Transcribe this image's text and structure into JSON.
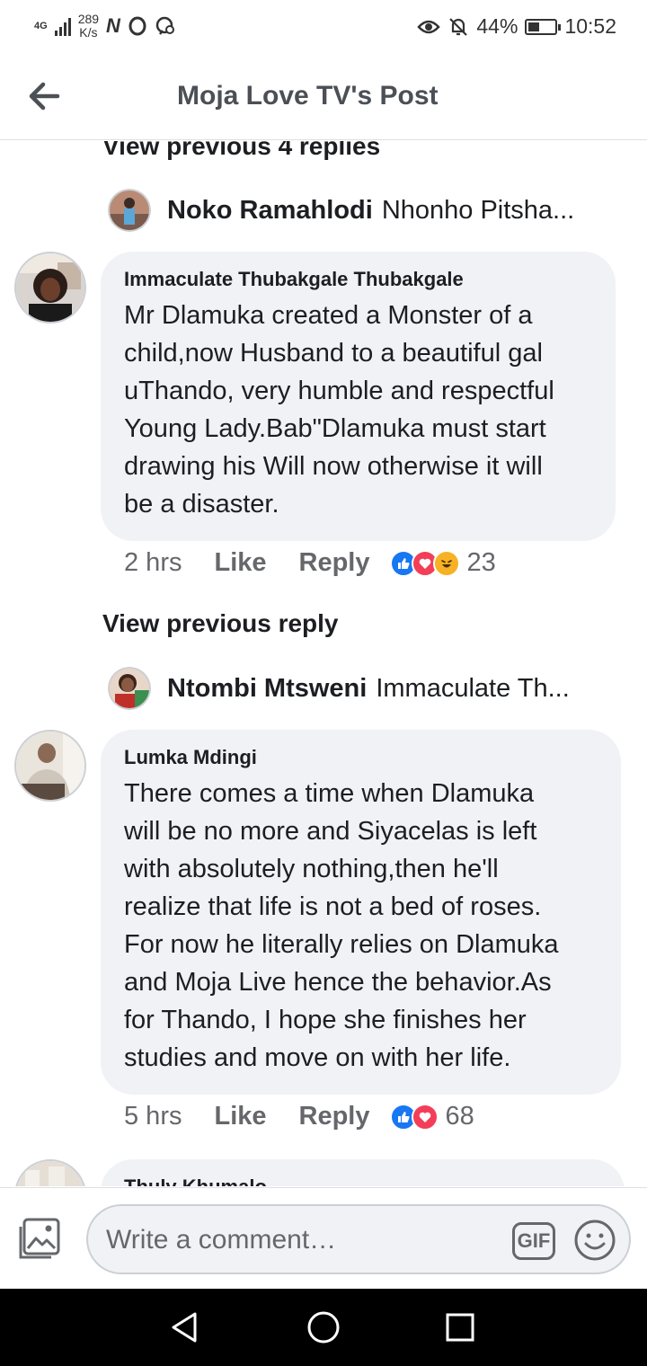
{
  "status_bar": {
    "network": "4G",
    "speed_value": "289",
    "speed_unit": "K/s",
    "glyph_n": "N",
    "battery_percent": "44%",
    "battery_level": 0.44,
    "time": "10:52"
  },
  "header": {
    "title": "Moja Love TV's Post"
  },
  "thread": {
    "view_previous_4": "View previous 4 replies",
    "reply_1": {
      "name": "Noko Ramahlodi",
      "preview": "Nhonho Pitsha..."
    },
    "comment_1": {
      "name": "Immaculate Thubakgale Thubakgale",
      "lines": [
        "Mr Dlamuka created a Monster of a",
        "child,now Husband to a beautiful gal",
        "uThando, very humble and respectful",
        "Young Lady.Bab\"Dlamuka must start",
        "drawing his Will now otherwise it will",
        "be a disaster."
      ],
      "time": "2 hrs",
      "like": "Like",
      "reply": "Reply",
      "reaction_count": "23"
    },
    "view_previous_reply": "View previous reply",
    "reply_2": {
      "name": "Ntombi Mtsweni",
      "preview": "Immaculate Th..."
    },
    "comment_2": {
      "name": "Lumka Mdingi",
      "lines": [
        "There comes a time when Dlamuka",
        "will be no more and Siyacelas is left",
        "with absolutely nothing,then he'll",
        "realize that life is not a bed of roses.",
        "For now he literally relies on Dlamuka",
        "and Moja Live hence the behavior.As",
        "for Thando, I hope she finishes her",
        "studies and move on with her life."
      ],
      "time": "5 hrs",
      "like": "Like",
      "reply": "Reply",
      "reaction_count": "68"
    },
    "comment_3": {
      "name": "Thuly Khumalo"
    }
  },
  "composer": {
    "placeholder": "Write a comment…",
    "gif_label": "GIF"
  },
  "colors": {
    "like_blue": "#1877f2",
    "love_red": "#f33e58",
    "haha_yellow": "#f7b125",
    "bubble_bg": "#f0f2f5",
    "meta_gray": "#65676b"
  },
  "icons": [
    "back-arrow-icon",
    "photo-icon",
    "gif-icon",
    "emoji-icon",
    "nav-back-icon",
    "nav-home-icon",
    "nav-recents-icon",
    "like-reaction-icon",
    "love-reaction-icon",
    "haha-reaction-icon"
  ]
}
